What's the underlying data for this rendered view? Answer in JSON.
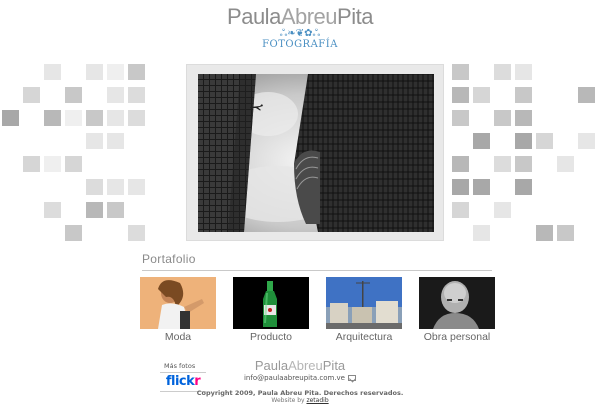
{
  "header": {
    "logo_part1": "Paula",
    "logo_part2": "Abreu",
    "logo_part3": "Pita",
    "ornament": "ஃ❧❦✿ஃ",
    "tagline": "FOTOGRAFÍA"
  },
  "hero": {
    "alt": "Skyscrapers from below with airplane"
  },
  "portfolio": {
    "title": "Portafolio",
    "items": [
      {
        "label": "Moda",
        "icon": "fashion-photo"
      },
      {
        "label": "Producto",
        "icon": "beer-bottle-photo"
      },
      {
        "label": "Arquitectura",
        "icon": "buildings-photo"
      },
      {
        "label": "Obra personal",
        "icon": "portrait-photo"
      }
    ]
  },
  "sidebar": {
    "mas_fotos": "Más fotos",
    "flickr_a": "flick",
    "flickr_b": "r"
  },
  "footer": {
    "logo_part1": "Paula",
    "logo_part2": "Abreu",
    "logo_part3": "Pita",
    "email": "info@paulaabreupita.com.ve",
    "copyright": "Copyright 2009, Paula Abreu Pita. Derechos reservados.",
    "credit_prefix": "Website by ",
    "credit_link": "zetadib"
  },
  "colors": {
    "accent": "#4a8fc2",
    "flickr_blue": "#0063dc",
    "flickr_pink": "#ff0084"
  }
}
